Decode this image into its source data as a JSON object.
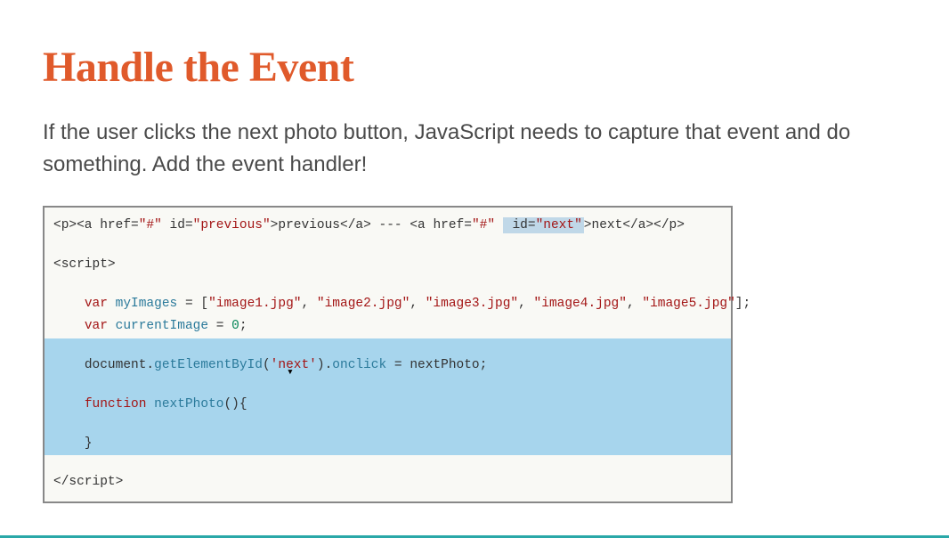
{
  "slide": {
    "title": "Handle the Event",
    "description": "If the user clicks the next photo button, JavaScript needs to capture that event and do something. Add the event handler!"
  },
  "code": {
    "line1": {
      "p_open": "<p>",
      "a1_open": "<a ",
      "href_attr": "href=",
      "href_val": "\"#\"",
      "id_attr": " id=",
      "id_prev_val": "\"previous\"",
      "close_tag": ">",
      "prev_text": "previous",
      "a_close": "</a>",
      "sep": " --- ",
      "a2_open": "<a ",
      "id_next_val": "\"next\"",
      "next_text": "next",
      "p_close": "</p>"
    },
    "line2": "<script>",
    "line3": {
      "indent": "    ",
      "var_kw": "var",
      "sp": " ",
      "var_name": "myImages",
      "eq": " = [",
      "img1": "\"image1.jpg\"",
      "comma": ", ",
      "img2": "\"image2.jpg\"",
      "img3": "\"image3.jpg\"",
      "img4": "\"image4.jpg\"",
      "img5": "\"image5.jpg\"",
      "end": "];"
    },
    "line4": {
      "indent": "    ",
      "var_kw": "var",
      "sp": " ",
      "var_name": "currentImage",
      "eq": " = ",
      "val": "0",
      "semi": ";"
    },
    "line5": {
      "indent": "    ",
      "doc": "document.",
      "method": "getElementById",
      "open": "(",
      "arg": "'next'",
      "close_dot": ").",
      "onclick": "onclick",
      "rest": " = nextPhoto;"
    },
    "line6": {
      "indent": "    ",
      "func_kw": "function",
      "sp": " ",
      "func_name": "nextPhoto",
      "rest": "(){"
    },
    "line7": {
      "indent": "    ",
      "brace": "}"
    },
    "line8_raw": "<",
    "line8_slash": "/script>"
  }
}
